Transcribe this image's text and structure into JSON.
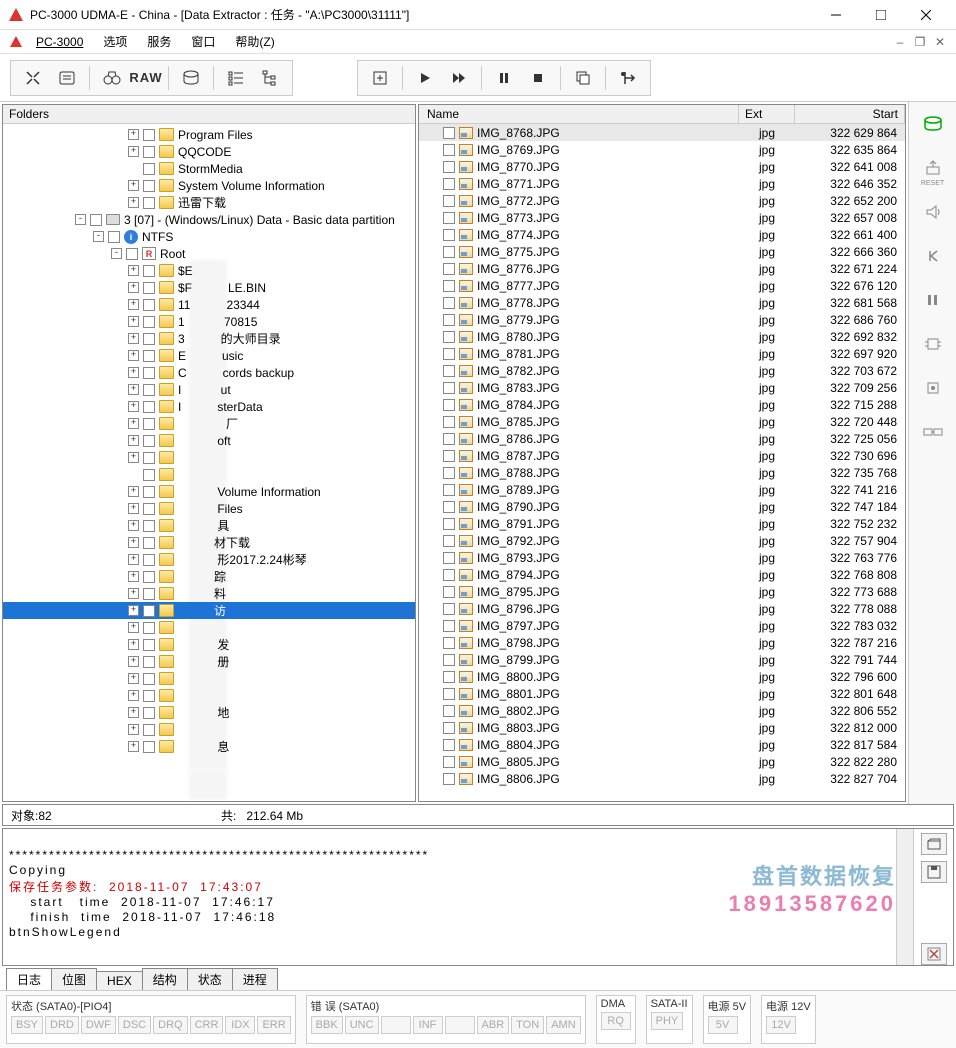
{
  "window": {
    "title": "PC-3000 UDMA-E - China - [Data Extractor : 任务 - \"A:\\PC3000\\31111\"]"
  },
  "menu": {
    "app": "PC-3000",
    "items": [
      "选项",
      "服务",
      "窗口",
      "帮助(Z)"
    ]
  },
  "toolbar": {
    "raw": "RAW"
  },
  "folders": {
    "header": "Folders",
    "tree": [
      {
        "ind": 125,
        "exp": "+",
        "t": "folder",
        "label": "Program Files"
      },
      {
        "ind": 125,
        "exp": "+",
        "t": "folder",
        "label": "QQCODE"
      },
      {
        "ind": 125,
        "exp": "",
        "t": "folder",
        "label": "StormMedia"
      },
      {
        "ind": 125,
        "exp": "+",
        "t": "folder",
        "label": "System Volume Information"
      },
      {
        "ind": 125,
        "exp": "+",
        "t": "folder",
        "label": "迅雷下载"
      },
      {
        "ind": 72,
        "exp": "-",
        "t": "disk",
        "label": "3 [07] - (Windows/Linux) Data - Basic data partition"
      },
      {
        "ind": 90,
        "exp": "-",
        "t": "ntfs",
        "label": "NTFS"
      },
      {
        "ind": 108,
        "exp": "-",
        "t": "root",
        "label": "Root"
      },
      {
        "ind": 125,
        "exp": "+",
        "t": "folder",
        "label": "$E"
      },
      {
        "ind": 125,
        "exp": "+",
        "t": "folder",
        "label": "$F　　　LE.BIN"
      },
      {
        "ind": 125,
        "exp": "+",
        "t": "folder",
        "label": "11　　　23344"
      },
      {
        "ind": 125,
        "exp": "+",
        "t": "folder",
        "label": "1　　　 70815"
      },
      {
        "ind": 125,
        "exp": "+",
        "t": "folder",
        "label": "3　　　的大师目录"
      },
      {
        "ind": 125,
        "exp": "+",
        "t": "folder",
        "label": "E　　　usic"
      },
      {
        "ind": 125,
        "exp": "+",
        "t": "folder",
        "label": "C　　　cords backup"
      },
      {
        "ind": 125,
        "exp": "+",
        "t": "folder",
        "label": "I　　　 ut"
      },
      {
        "ind": 125,
        "exp": "+",
        "t": "folder",
        "label": "I　　　sterData"
      },
      {
        "ind": 125,
        "exp": "+",
        "t": "folder",
        "label": "　　　　厂"
      },
      {
        "ind": 125,
        "exp": "+",
        "t": "folder",
        "label": "　　　 oft"
      },
      {
        "ind": 125,
        "exp": "+",
        "t": "folder",
        "label": ""
      },
      {
        "ind": 125,
        "exp": "",
        "t": "folder",
        "label": ""
      },
      {
        "ind": 125,
        "exp": "+",
        "t": "folder",
        "label": "　　　 Volume Information"
      },
      {
        "ind": 125,
        "exp": "+",
        "t": "folder",
        "label": "　　　 Files"
      },
      {
        "ind": 125,
        "exp": "+",
        "t": "folder",
        "label": "　　　 具"
      },
      {
        "ind": 125,
        "exp": "+",
        "t": "folder",
        "label": "　　　材下载"
      },
      {
        "ind": 125,
        "exp": "+",
        "t": "folder",
        "label": "　　　 形2017.2.24彬琴"
      },
      {
        "ind": 125,
        "exp": "+",
        "t": "folder",
        "label": "　　　踪"
      },
      {
        "ind": 125,
        "exp": "+",
        "t": "folder",
        "label": "　　　料"
      },
      {
        "ind": 125,
        "exp": "+",
        "t": "folder",
        "label": "　　　访",
        "sel": true
      },
      {
        "ind": 125,
        "exp": "+",
        "t": "folder",
        "label": ""
      },
      {
        "ind": 125,
        "exp": "+",
        "t": "folder",
        "label": "　　　 发"
      },
      {
        "ind": 125,
        "exp": "+",
        "t": "folder",
        "label": "　　　 册"
      },
      {
        "ind": 125,
        "exp": "+",
        "t": "folder",
        "label": ""
      },
      {
        "ind": 125,
        "exp": "+",
        "t": "folder",
        "label": ""
      },
      {
        "ind": 125,
        "exp": "+",
        "t": "folder",
        "label": "　　　 地"
      },
      {
        "ind": 125,
        "exp": "+",
        "t": "folder",
        "label": ""
      },
      {
        "ind": 125,
        "exp": "+",
        "t": "folder",
        "label": "　　　 息"
      }
    ]
  },
  "filecols": {
    "name": "Name",
    "ext": "Ext",
    "start": "Start"
  },
  "files": [
    {
      "n": "IMG_8768.JPG",
      "e": "jpg",
      "s": "322 629 864",
      "sel": true
    },
    {
      "n": "IMG_8769.JPG",
      "e": "jpg",
      "s": "322 635 864"
    },
    {
      "n": "IMG_8770.JPG",
      "e": "jpg",
      "s": "322 641 008"
    },
    {
      "n": "IMG_8771.JPG",
      "e": "jpg",
      "s": "322 646 352"
    },
    {
      "n": "IMG_8772.JPG",
      "e": "jpg",
      "s": "322 652 200"
    },
    {
      "n": "IMG_8773.JPG",
      "e": "jpg",
      "s": "322 657 008"
    },
    {
      "n": "IMG_8774.JPG",
      "e": "jpg",
      "s": "322 661 400"
    },
    {
      "n": "IMG_8775.JPG",
      "e": "jpg",
      "s": "322 666 360"
    },
    {
      "n": "IMG_8776.JPG",
      "e": "jpg",
      "s": "322 671 224"
    },
    {
      "n": "IMG_8777.JPG",
      "e": "jpg",
      "s": "322 676 120"
    },
    {
      "n": "IMG_8778.JPG",
      "e": "jpg",
      "s": "322 681 568"
    },
    {
      "n": "IMG_8779.JPG",
      "e": "jpg",
      "s": "322 686 760"
    },
    {
      "n": "IMG_8780.JPG",
      "e": "jpg",
      "s": "322 692 832"
    },
    {
      "n": "IMG_8781.JPG",
      "e": "jpg",
      "s": "322 697 920"
    },
    {
      "n": "IMG_8782.JPG",
      "e": "jpg",
      "s": "322 703 672"
    },
    {
      "n": "IMG_8783.JPG",
      "e": "jpg",
      "s": "322 709 256"
    },
    {
      "n": "IMG_8784.JPG",
      "e": "jpg",
      "s": "322 715 288"
    },
    {
      "n": "IMG_8785.JPG",
      "e": "jpg",
      "s": "322 720 448"
    },
    {
      "n": "IMG_8786.JPG",
      "e": "jpg",
      "s": "322 725 056"
    },
    {
      "n": "IMG_8787.JPG",
      "e": "jpg",
      "s": "322 730 696"
    },
    {
      "n": "IMG_8788.JPG",
      "e": "jpg",
      "s": "322 735 768"
    },
    {
      "n": "IMG_8789.JPG",
      "e": "jpg",
      "s": "322 741 216"
    },
    {
      "n": "IMG_8790.JPG",
      "e": "jpg",
      "s": "322 747 184"
    },
    {
      "n": "IMG_8791.JPG",
      "e": "jpg",
      "s": "322 752 232"
    },
    {
      "n": "IMG_8792.JPG",
      "e": "jpg",
      "s": "322 757 904"
    },
    {
      "n": "IMG_8793.JPG",
      "e": "jpg",
      "s": "322 763 776"
    },
    {
      "n": "IMG_8794.JPG",
      "e": "jpg",
      "s": "322 768 808"
    },
    {
      "n": "IMG_8795.JPG",
      "e": "jpg",
      "s": "322 773 688"
    },
    {
      "n": "IMG_8796.JPG",
      "e": "jpg",
      "s": "322 778 088"
    },
    {
      "n": "IMG_8797.JPG",
      "e": "jpg",
      "s": "322 783 032"
    },
    {
      "n": "IMG_8798.JPG",
      "e": "jpg",
      "s": "322 787 216"
    },
    {
      "n": "IMG_8799.JPG",
      "e": "jpg",
      "s": "322 791 744"
    },
    {
      "n": "IMG_8800.JPG",
      "e": "jpg",
      "s": "322 796 600"
    },
    {
      "n": "IMG_8801.JPG",
      "e": "jpg",
      "s": "322 801 648"
    },
    {
      "n": "IMG_8802.JPG",
      "e": "jpg",
      "s": "322 806 552"
    },
    {
      "n": "IMG_8803.JPG",
      "e": "jpg",
      "s": "322 812 000"
    },
    {
      "n": "IMG_8804.JPG",
      "e": "jpg",
      "s": "322 817 584"
    },
    {
      "n": "IMG_8805.JPG",
      "e": "jpg",
      "s": "322 822 280"
    },
    {
      "n": "IMG_8806.JPG",
      "e": "jpg",
      "s": "322 827 704"
    }
  ],
  "status": {
    "objects_lbl": "对象:",
    "objects": "82",
    "total_lbl": "共:",
    "total": "212.64 Mb"
  },
  "log": {
    "l1": "***************************************************************",
    "l2": "Copying",
    "l3": "保存任务参数:  2018-11-07  17:43:07",
    "l4": "    start   time  2018-11-07  17:46:17",
    "l5": "    finish  time  2018-11-07  17:46:18",
    "l6": "btnShowLegend"
  },
  "tabs": [
    "日志",
    "位图",
    "HEX",
    "结构",
    "状态",
    "进程"
  ],
  "bottom": {
    "g1": {
      "title": "状态 (SATA0)-[PIO4]",
      "cells": [
        "BSY",
        "DRD",
        "DWF",
        "DSC",
        "DRQ",
        "CRR",
        "IDX",
        "ERR"
      ]
    },
    "g2": {
      "title": "错 误 (SATA0)",
      "cells": [
        "BBK",
        "UNC",
        "",
        "INF",
        "",
        "ABR",
        "TON",
        "AMN"
      ]
    },
    "g3": {
      "title": "DMA",
      "cells": [
        "RQ"
      ]
    },
    "g4": {
      "title": "SATA-II",
      "cells": [
        "PHY"
      ]
    },
    "g5": {
      "title": "电源 5V",
      "cells": [
        "5V"
      ]
    },
    "g6": {
      "title": "电源 12V",
      "cells": [
        "12V"
      ]
    }
  },
  "watermark": {
    "l1": "盘首数据恢复",
    "l2": "18913587620"
  },
  "sidebar_label": "RESET"
}
